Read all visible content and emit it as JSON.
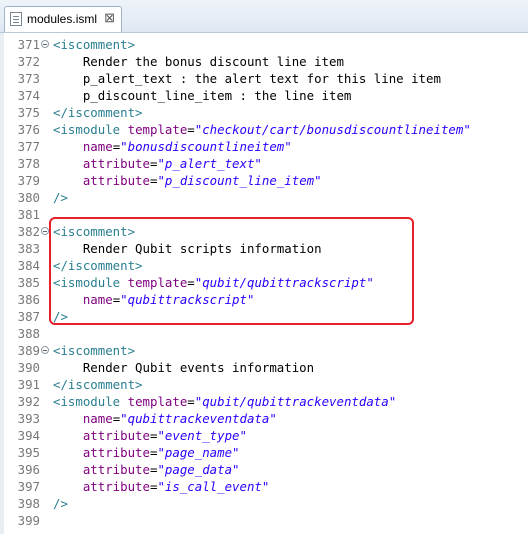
{
  "tab": {
    "filename": "modules.isml",
    "close_glyph": "⊠"
  },
  "lines": [
    {
      "num": "371",
      "indent": "",
      "tokens": [
        {
          "cls": "tag",
          "text": "<iscomment>"
        }
      ],
      "fold": true
    },
    {
      "num": "372",
      "indent": "    ",
      "tokens": [
        {
          "cls": "txt",
          "text": "Render the bonus discount line item"
        }
      ]
    },
    {
      "num": "373",
      "indent": "    ",
      "tokens": [
        {
          "cls": "txt",
          "text": "p_alert_text : the alert text for this line item"
        }
      ]
    },
    {
      "num": "374",
      "indent": "    ",
      "tokens": [
        {
          "cls": "txt",
          "text": "p_discount_line_item : the line item"
        }
      ]
    },
    {
      "num": "375",
      "indent": "",
      "tokens": [
        {
          "cls": "tag",
          "text": "</iscomment>"
        }
      ]
    },
    {
      "num": "376",
      "indent": "",
      "tokens": [
        {
          "cls": "tag",
          "text": "<ismodule "
        },
        {
          "cls": "attr",
          "text": "template"
        },
        {
          "cls": "txt",
          "text": "="
        },
        {
          "cls": "val",
          "text": "\"checkout/cart/bonusdiscountlineitem\""
        }
      ]
    },
    {
      "num": "377",
      "indent": "    ",
      "tokens": [
        {
          "cls": "attr",
          "text": "name"
        },
        {
          "cls": "txt",
          "text": "="
        },
        {
          "cls": "val",
          "text": "\"bonusdiscountlineitem\""
        }
      ]
    },
    {
      "num": "378",
      "indent": "    ",
      "tokens": [
        {
          "cls": "attr",
          "text": "attribute"
        },
        {
          "cls": "txt",
          "text": "="
        },
        {
          "cls": "val",
          "text": "\"p_alert_text\""
        }
      ]
    },
    {
      "num": "379",
      "indent": "    ",
      "tokens": [
        {
          "cls": "attr",
          "text": "attribute"
        },
        {
          "cls": "txt",
          "text": "="
        },
        {
          "cls": "val",
          "text": "\"p_discount_line_item\""
        }
      ]
    },
    {
      "num": "380",
      "indent": "",
      "tokens": [
        {
          "cls": "tag",
          "text": "/>"
        }
      ]
    },
    {
      "num": "381",
      "indent": "",
      "tokens": []
    },
    {
      "num": "382",
      "indent": "",
      "tokens": [
        {
          "cls": "tag",
          "text": "<iscomment>"
        }
      ],
      "fold": true
    },
    {
      "num": "383",
      "indent": "    ",
      "tokens": [
        {
          "cls": "txt",
          "text": "Render Qubit scripts information"
        }
      ]
    },
    {
      "num": "384",
      "indent": "",
      "tokens": [
        {
          "cls": "tag",
          "text": "</iscomment>"
        }
      ]
    },
    {
      "num": "385",
      "indent": "",
      "tokens": [
        {
          "cls": "tag",
          "text": "<ismodule "
        },
        {
          "cls": "attr",
          "text": "template"
        },
        {
          "cls": "txt",
          "text": "="
        },
        {
          "cls": "val",
          "text": "\"qubit/qubittrackscript\""
        }
      ]
    },
    {
      "num": "386",
      "indent": "    ",
      "tokens": [
        {
          "cls": "attr",
          "text": "name"
        },
        {
          "cls": "txt",
          "text": "="
        },
        {
          "cls": "val",
          "text": "\"qubittrackscript\""
        }
      ]
    },
    {
      "num": "387",
      "indent": "",
      "tokens": [
        {
          "cls": "tag",
          "text": "/>"
        }
      ]
    },
    {
      "num": "388",
      "indent": "",
      "tokens": []
    },
    {
      "num": "389",
      "indent": "",
      "tokens": [
        {
          "cls": "tag",
          "text": "<iscomment>"
        }
      ],
      "fold": true
    },
    {
      "num": "390",
      "indent": "    ",
      "tokens": [
        {
          "cls": "txt",
          "text": "Render Qubit events information"
        }
      ]
    },
    {
      "num": "391",
      "indent": "",
      "tokens": [
        {
          "cls": "tag",
          "text": "</iscomment>"
        }
      ]
    },
    {
      "num": "392",
      "indent": "",
      "tokens": [
        {
          "cls": "tag",
          "text": "<ismodule "
        },
        {
          "cls": "attr",
          "text": "template"
        },
        {
          "cls": "txt",
          "text": "="
        },
        {
          "cls": "val",
          "text": "\"qubit/qubittrackeventdata\""
        }
      ]
    },
    {
      "num": "393",
      "indent": "    ",
      "tokens": [
        {
          "cls": "attr",
          "text": "name"
        },
        {
          "cls": "txt",
          "text": "="
        },
        {
          "cls": "val",
          "text": "\"qubittrackeventdata\""
        }
      ]
    },
    {
      "num": "394",
      "indent": "    ",
      "tokens": [
        {
          "cls": "attr",
          "text": "attribute"
        },
        {
          "cls": "txt",
          "text": "="
        },
        {
          "cls": "val",
          "text": "\"event_type\""
        }
      ]
    },
    {
      "num": "395",
      "indent": "    ",
      "tokens": [
        {
          "cls": "attr",
          "text": "attribute"
        },
        {
          "cls": "txt",
          "text": "="
        },
        {
          "cls": "val",
          "text": "\"page_name\""
        }
      ]
    },
    {
      "num": "396",
      "indent": "    ",
      "tokens": [
        {
          "cls": "attr",
          "text": "attribute"
        },
        {
          "cls": "txt",
          "text": "="
        },
        {
          "cls": "val",
          "text": "\"page_data\""
        }
      ]
    },
    {
      "num": "397",
      "indent": "    ",
      "tokens": [
        {
          "cls": "attr",
          "text": "attribute"
        },
        {
          "cls": "txt",
          "text": "="
        },
        {
          "cls": "val",
          "text": "\"is_call_event\""
        }
      ]
    },
    {
      "num": "398",
      "indent": "",
      "tokens": [
        {
          "cls": "tag",
          "text": "/>"
        }
      ]
    },
    {
      "num": "399",
      "indent": "",
      "tokens": []
    }
  ],
  "colors": {
    "tag": "#2a7f8f",
    "attribute": "#7f007f",
    "string": "#2a00ff",
    "line_number": "#787878",
    "highlight": "#e5202a"
  }
}
